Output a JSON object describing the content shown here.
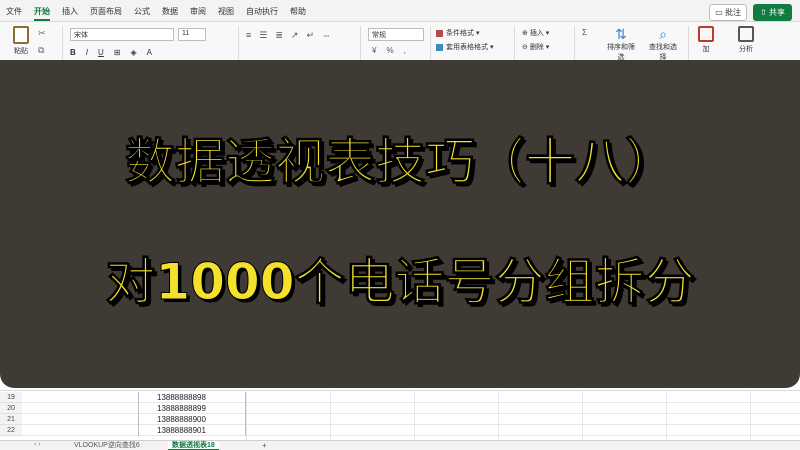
{
  "ribbon_tabs": [
    "文件",
    "开始",
    "插入",
    "页面布局",
    "公式",
    "数据",
    "审阅",
    "视图",
    "自动执行",
    "帮助"
  ],
  "active_tab": "开始",
  "top_right": {
    "comment": "批注",
    "share": "共享"
  },
  "clipboard": {
    "paste": "粘贴"
  },
  "font": {
    "name": "宋体",
    "size": "11"
  },
  "number_format": "常规",
  "styles": {
    "conditional": "条件格式",
    "table_format": "套用表格格式"
  },
  "cells_group": {
    "insert": "插入",
    "delete": "删除"
  },
  "editing": {
    "sort_filter": "排序和筛选",
    "find_select": "查找和选择"
  },
  "addins": "加",
  "analyze": "分析",
  "overlay": {
    "title_line1": "数据透视表技巧（十八）",
    "title_line2": "对1000个电话号分组拆分"
  },
  "rows": [
    {
      "row": "19",
      "value": "13888888898"
    },
    {
      "row": "20",
      "value": "13888888899"
    },
    {
      "row": "21",
      "value": "13888888900"
    },
    {
      "row": "22",
      "value": "13888888901"
    }
  ],
  "sheet_tabs": [
    "VLOOKUP逆向查找6",
    "数据透视表18"
  ],
  "active_sheet": "数据透视表18",
  "add_sheet": "+",
  "colors": {
    "accent": "#107c41",
    "overlay_bg": "#3f3a33",
    "title_text": "#f5e12c"
  }
}
